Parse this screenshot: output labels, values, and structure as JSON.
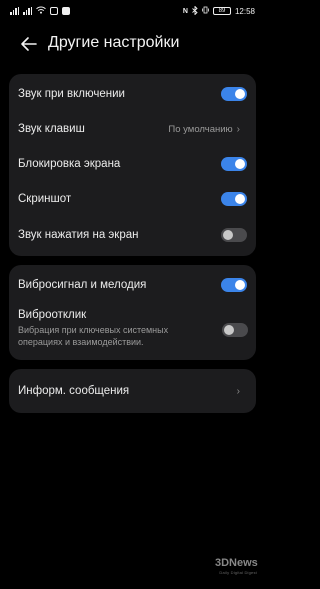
{
  "status_bar": {
    "time": "12:58",
    "battery": "89"
  },
  "header": {
    "title": "Другие настройки"
  },
  "group1": [
    {
      "label": "Звук при включении",
      "toggle": true
    },
    {
      "label": "Звук клавиш",
      "value": "По умолчанию"
    },
    {
      "label": "Блокировка экрана",
      "toggle": true
    },
    {
      "label": "Скриншот",
      "toggle": true
    },
    {
      "label": "Звук нажатия на экран",
      "toggle": false
    }
  ],
  "group2": {
    "vibro_melody": {
      "label": "Вибросигнал и мелодия",
      "toggle": true
    },
    "vibro_response": {
      "label": "Виброотклик",
      "subtitle": "Вибрация при ключевых системных операциях и взаимодействии.",
      "toggle": false
    }
  },
  "group3": {
    "info_messages": {
      "label": "Информ. сообщения"
    }
  },
  "watermark": {
    "logo": "3DNews",
    "tagline": "Daily Digital Digest"
  },
  "colors": {
    "background": "#000000",
    "card": "#1c1c1e",
    "accent": "#3b84e9"
  }
}
